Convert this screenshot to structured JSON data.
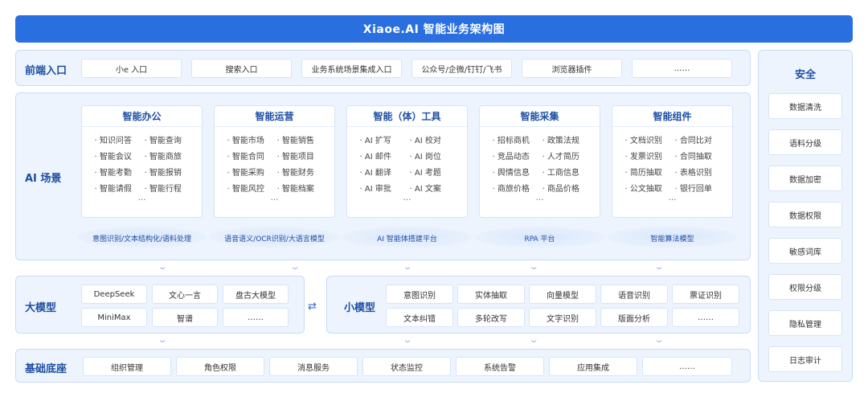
{
  "title": "Xiaoe.AI 智能业务架构图",
  "frontend": {
    "label": "前端入口",
    "items": [
      "小e 入口",
      "搜索入口",
      "业务系统场景集成入口",
      "公众号/企微/钉钉/飞书",
      "浏览器插件",
      "……"
    ]
  },
  "ai_scene": {
    "label": "AI 场景",
    "cards": [
      {
        "title": "智能办公",
        "items": [
          "· 知识问答",
          "· 智能查询",
          "· 智能会议",
          "· 智能商旅",
          "· 智能考勤",
          "· 智能报销",
          "· 智能请假",
          "· 智能行程"
        ],
        "more": "…",
        "platform": "意图识别/文本结构化/语料处理"
      },
      {
        "title": "智能运营",
        "items": [
          "· 智能市场",
          "· 智能销售",
          "· 智能合同",
          "· 智能项目",
          "· 智能采购",
          "· 智能财务",
          "· 智能风控",
          "· 智能档案"
        ],
        "more": "…",
        "platform": "语音语义/OCR识别/大语言模型"
      },
      {
        "title": "智能（体）工具",
        "items": [
          "· AI 扩写",
          "· AI 校对",
          "· AI 邮件",
          "· AI 岗位",
          "· AI 翻译",
          "· AI 考题",
          "· AI 审批",
          "· AI 文案"
        ],
        "more": "…",
        "platform": "AI 智能体搭建平台"
      },
      {
        "title": "智能采集",
        "items": [
          "· 招标商机",
          "· 政策法规",
          "· 竞品动态",
          "· 人才简历",
          "· 舆情信息",
          "· 工商信息",
          "· 商旅价格",
          "· 商品价格"
        ],
        "more": "…",
        "platform": "RPA 平台"
      },
      {
        "title": "智能组件",
        "items": [
          "· 文档识别",
          "· 合同比对",
          "· 发票识别",
          "· 合同抽取",
          "· 简历抽取",
          "· 表格识别",
          "· 公文抽取",
          "· 银行回单"
        ],
        "more": "…",
        "platform": "智能算法模型"
      }
    ]
  },
  "large_model": {
    "label": "大模型",
    "items": [
      "DeepSeek",
      "文心一言",
      "盘古大模型",
      "MiniMax",
      "智谱",
      "……"
    ]
  },
  "small_model": {
    "label": "小模型",
    "items": [
      "意图识别",
      "实体抽取",
      "向量模型",
      "语音识别",
      "票证识别",
      "文本纠错",
      "多轮改写",
      "文字识别",
      "版面分析",
      "……"
    ]
  },
  "foundation": {
    "label": "基础底座",
    "items": [
      "组织管理",
      "角色权限",
      "消息服务",
      "状态监控",
      "系统告警",
      "应用集成",
      "……"
    ]
  },
  "security": {
    "label": "安全",
    "items": [
      "数据清洗",
      "语料分级",
      "数据加密",
      "数据权限",
      "敏感词库",
      "权限分级",
      "隐私管理",
      "日志审计"
    ]
  },
  "icons": {
    "chevron": "chevron-down-icon",
    "swap": "swap-arrows-icon"
  },
  "colors": {
    "accent": "#2a6fe0",
    "panel": "#eef4fd",
    "label": "#1d4fa3"
  }
}
